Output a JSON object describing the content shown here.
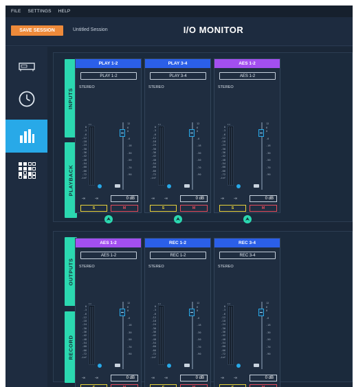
{
  "menu": {
    "file": "FILE",
    "settings": "SETTINGS",
    "help": "HELP"
  },
  "header": {
    "save_button": "SAVE SESSION",
    "session_name": "Untitled Session",
    "title": "I/O MONITOR"
  },
  "sidebar": {
    "items": [
      "device",
      "clock",
      "meters",
      "matrix"
    ],
    "active": "meters"
  },
  "sections": {
    "top_tabs": [
      "INPUTS",
      "PLAYBACK"
    ],
    "bottom_tabs": [
      "OUTPUTS",
      "RECORD"
    ]
  },
  "strips_top": [
    {
      "name": "PLAY 1-2",
      "select": "PLAY 1-2",
      "mode": "STEREO",
      "color": "#2b5fe8"
    },
    {
      "name": "PLAY 3-4",
      "select": "PLAY 3-4",
      "mode": "STEREO",
      "color": "#2b5fe8"
    },
    {
      "name": "AES 1-2",
      "select": "AES 1-2",
      "mode": "STEREO",
      "color": "#a34ff0"
    }
  ],
  "strips_bottom": [
    {
      "name": "AES 1-2",
      "select": "AES 1-2",
      "mode": "STEREO",
      "color": "#a34ff0"
    },
    {
      "name": "REC 1-2",
      "select": "REC 1-2",
      "mode": "STEREO",
      "color": "#2b5fe8"
    },
    {
      "name": "REC 3-4",
      "select": "REC 3-4",
      "mode": "STEREO",
      "color": "#2b5fe8"
    }
  ],
  "strip_common": {
    "meter_scale": [
      "0",
      "-3",
      "-6",
      "-12",
      "-18",
      "-24",
      "-30",
      "-36",
      "-42",
      "-48",
      "-54",
      "-60",
      "-66",
      "-72",
      "-inf"
    ],
    "fader_scale": [
      "12",
      "6",
      "0",
      "-6",
      "-18",
      "-30",
      "-50",
      "-70",
      "-90"
    ],
    "peak_left": "-∞",
    "peak_right": "-∞",
    "level": "0 dB",
    "solo": "S",
    "mute": "M"
  }
}
